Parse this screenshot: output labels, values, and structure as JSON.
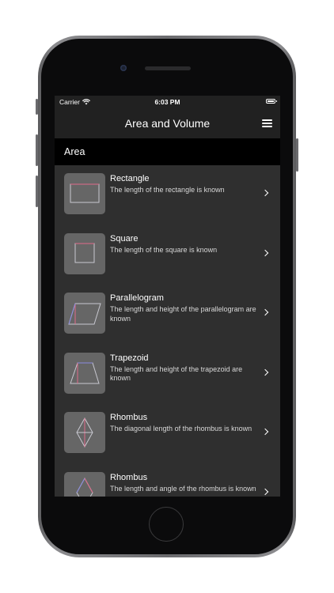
{
  "status": {
    "carrier": "Carrier",
    "time": "6:03 PM"
  },
  "nav": {
    "title": "Area and Volume",
    "menu_icon": "hamburger-menu-icon"
  },
  "section": {
    "title": "Area"
  },
  "items": [
    {
      "title": "Rectangle",
      "description": "The length of the rectangle is known",
      "icon": "rectangle-shape-icon"
    },
    {
      "title": "Square",
      "description": "The length of the square is known",
      "icon": "square-shape-icon"
    },
    {
      "title": "Parallelogram",
      "description": "The length and height of the parallelogram are known",
      "icon": "parallelogram-shape-icon"
    },
    {
      "title": "Trapezoid",
      "description": "The length and height of the trapezoid are known",
      "icon": "trapezoid-shape-icon"
    },
    {
      "title": "Rhombus",
      "description": "The diagonal length of the rhombus is known",
      "icon": "rhombus-diagonal-shape-icon"
    },
    {
      "title": "Rhombus",
      "description": "The length and angle of the rhombus is known",
      "icon": "rhombus-angle-shape-icon"
    }
  ],
  "colors": {
    "screen_bg": "#2f2f2f",
    "bar_bg": "#212121",
    "section_bg": "#000000",
    "thumb_bg": "#666666"
  }
}
